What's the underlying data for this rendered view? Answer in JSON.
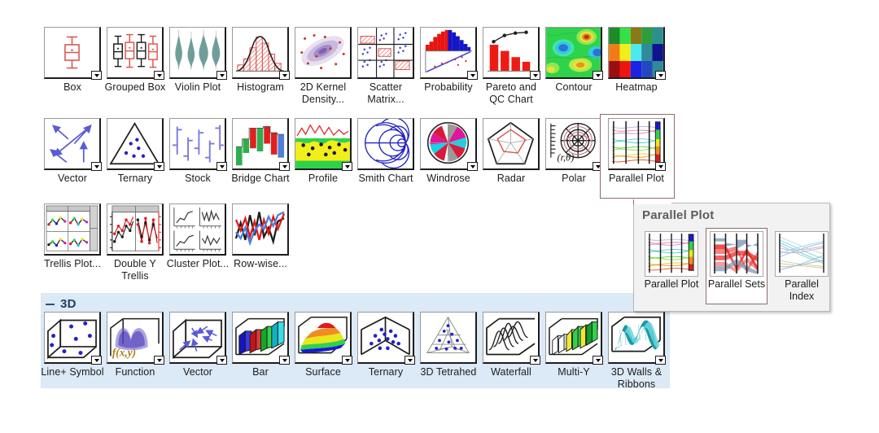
{
  "gallery": {
    "rows": [
      {
        "items": [
          {
            "label": "Box",
            "icon": "box-plot-icon",
            "dropdown": true
          },
          {
            "label": "Grouped Box",
            "icon": "grouped-box-plot-icon",
            "dropdown": true
          },
          {
            "label": "Violin Plot",
            "icon": "violin-plot-icon",
            "dropdown": true
          },
          {
            "label": "Histogram",
            "icon": "histogram-icon",
            "dropdown": true
          },
          {
            "label": "2D Kernel Density...",
            "icon": "kernel-density-icon",
            "dropdown": false
          },
          {
            "label": "Scatter Matrix...",
            "icon": "scatter-matrix-icon",
            "dropdown": false
          },
          {
            "label": "Probability",
            "icon": "probability-plot-icon",
            "dropdown": true
          },
          {
            "label": "Pareto and QC Chart",
            "icon": "pareto-qc-chart-icon",
            "dropdown": true
          },
          {
            "label": "Contour",
            "icon": "contour-plot-icon",
            "dropdown": true
          },
          {
            "label": "Heatmap",
            "icon": "heatmap-icon",
            "dropdown": true
          }
        ]
      },
      {
        "items": [
          {
            "label": "Vector",
            "icon": "vector-plot-icon",
            "dropdown": true
          },
          {
            "label": "Ternary",
            "icon": "ternary-plot-icon",
            "dropdown": true
          },
          {
            "label": "Stock",
            "icon": "stock-chart-icon",
            "dropdown": true
          },
          {
            "label": "Bridge Chart",
            "icon": "bridge-chart-icon",
            "dropdown": true
          },
          {
            "label": "Profile",
            "icon": "profile-plot-icon",
            "dropdown": true
          },
          {
            "label": "Smith Chart",
            "icon": "smith-chart-icon",
            "dropdown": false
          },
          {
            "label": "Windrose",
            "icon": "windrose-icon",
            "dropdown": true
          },
          {
            "label": "Radar",
            "icon": "radar-chart-icon",
            "dropdown": false
          },
          {
            "label": "Polar",
            "icon": "polar-plot-icon",
            "dropdown": true
          },
          {
            "label": "Parallel Plot",
            "icon": "parallel-plot-icon",
            "dropdown": true,
            "selected": true
          }
        ]
      },
      {
        "items": [
          {
            "label": "Trellis Plot...",
            "icon": "trellis-plot-icon",
            "dropdown": false
          },
          {
            "label": "Double Y Trellis",
            "icon": "double-y-trellis-icon",
            "dropdown": false
          },
          {
            "label": "Cluster Plot...",
            "icon": "cluster-plot-icon",
            "dropdown": false
          },
          {
            "label": "Row-wise...",
            "icon": "row-wise-plot-icon",
            "dropdown": false
          }
        ]
      }
    ]
  },
  "section_3d": {
    "title": "3D",
    "collapse_icon": "minus-icon",
    "items": [
      {
        "label": "Line+ Symbol",
        "icon": "3d-line-symbol-icon",
        "dropdown": true
      },
      {
        "label": "Function",
        "icon": "3d-function-icon",
        "dropdown": true
      },
      {
        "label": "Vector",
        "icon": "3d-vector-icon",
        "dropdown": true
      },
      {
        "label": "Bar",
        "icon": "3d-bar-icon",
        "dropdown": true
      },
      {
        "label": "Surface",
        "icon": "3d-surface-icon",
        "dropdown": true
      },
      {
        "label": "Ternary",
        "icon": "3d-ternary-icon",
        "dropdown": true
      },
      {
        "label": "3D Tetrahed",
        "icon": "3d-tetrahedron-icon",
        "dropdown": false
      },
      {
        "label": "Waterfall",
        "icon": "waterfall-icon",
        "dropdown": true
      },
      {
        "label": "Multi-Y",
        "icon": "multi-y-icon",
        "dropdown": true
      },
      {
        "label": "3D Walls & Ribbons",
        "icon": "3d-walls-ribbons-icon",
        "dropdown": true
      }
    ]
  },
  "flyout": {
    "title": "Parallel Plot",
    "items": [
      {
        "label": "Parallel Plot",
        "icon": "parallel-plot-icon",
        "selected": false
      },
      {
        "label": "Parallel Sets",
        "icon": "parallel-sets-icon",
        "selected": true
      },
      {
        "label": "Parallel Index",
        "icon": "parallel-index-icon",
        "selected": false
      }
    ]
  },
  "colors": {
    "section_background": "#dce9f6",
    "section_title": "#1f3e5e",
    "selection_border": "#8b6c6c",
    "flyout_background": "#f2f2f2"
  }
}
